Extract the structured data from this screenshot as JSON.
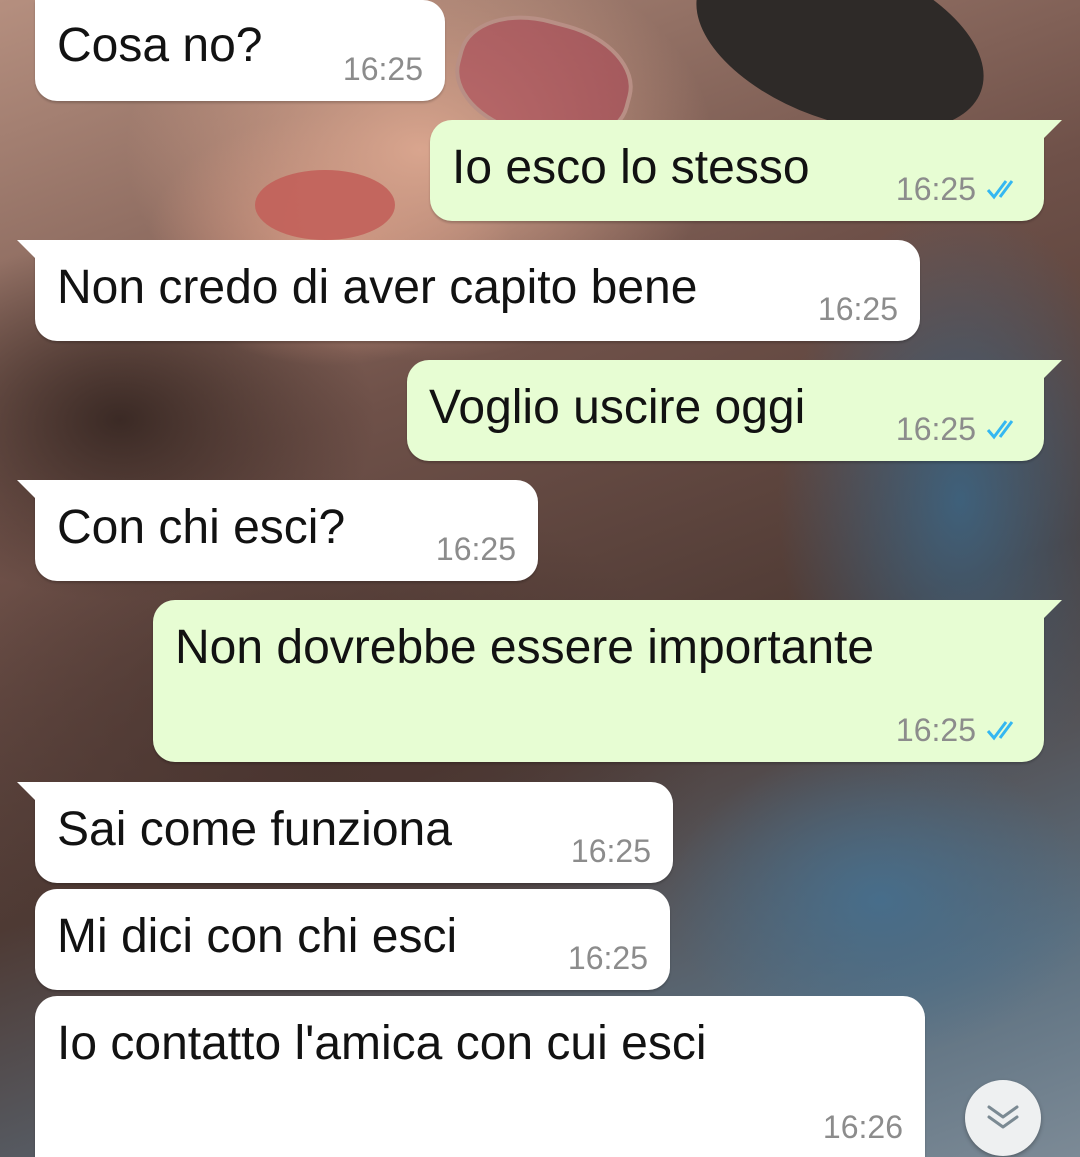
{
  "messages": [
    {
      "text": "Cosa no?",
      "time": "16:25",
      "direction": "incoming"
    },
    {
      "text": "Io esco lo stesso",
      "time": "16:25",
      "direction": "outgoing",
      "status": "read"
    },
    {
      "text": "Non credo di aver capito bene",
      "time": "16:25",
      "direction": "incoming"
    },
    {
      "text": "Voglio uscire oggi",
      "time": "16:25",
      "direction": "outgoing",
      "status": "read"
    },
    {
      "text": "Con chi esci?",
      "time": "16:25",
      "direction": "incoming"
    },
    {
      "text": "Non dovrebbe essere importante",
      "time": "16:25",
      "direction": "outgoing",
      "status": "read"
    },
    {
      "text": "Sai come funziona",
      "time": "16:25",
      "direction": "incoming"
    },
    {
      "text": "Mi dici con chi esci",
      "time": "16:25",
      "direction": "incoming"
    },
    {
      "text": "Io contatto l'amica con cui esci",
      "time": "16:26",
      "direction": "incoming"
    }
  ],
  "icons": {
    "read_receipt": "double-check-icon",
    "scroll_down": "chevron-double-down-icon"
  },
  "colors": {
    "incoming_bubble": "#ffffff",
    "outgoing_bubble": "#e7fdd3",
    "read_ticks": "#34b7f1",
    "timestamp": "#8c8c8c"
  }
}
